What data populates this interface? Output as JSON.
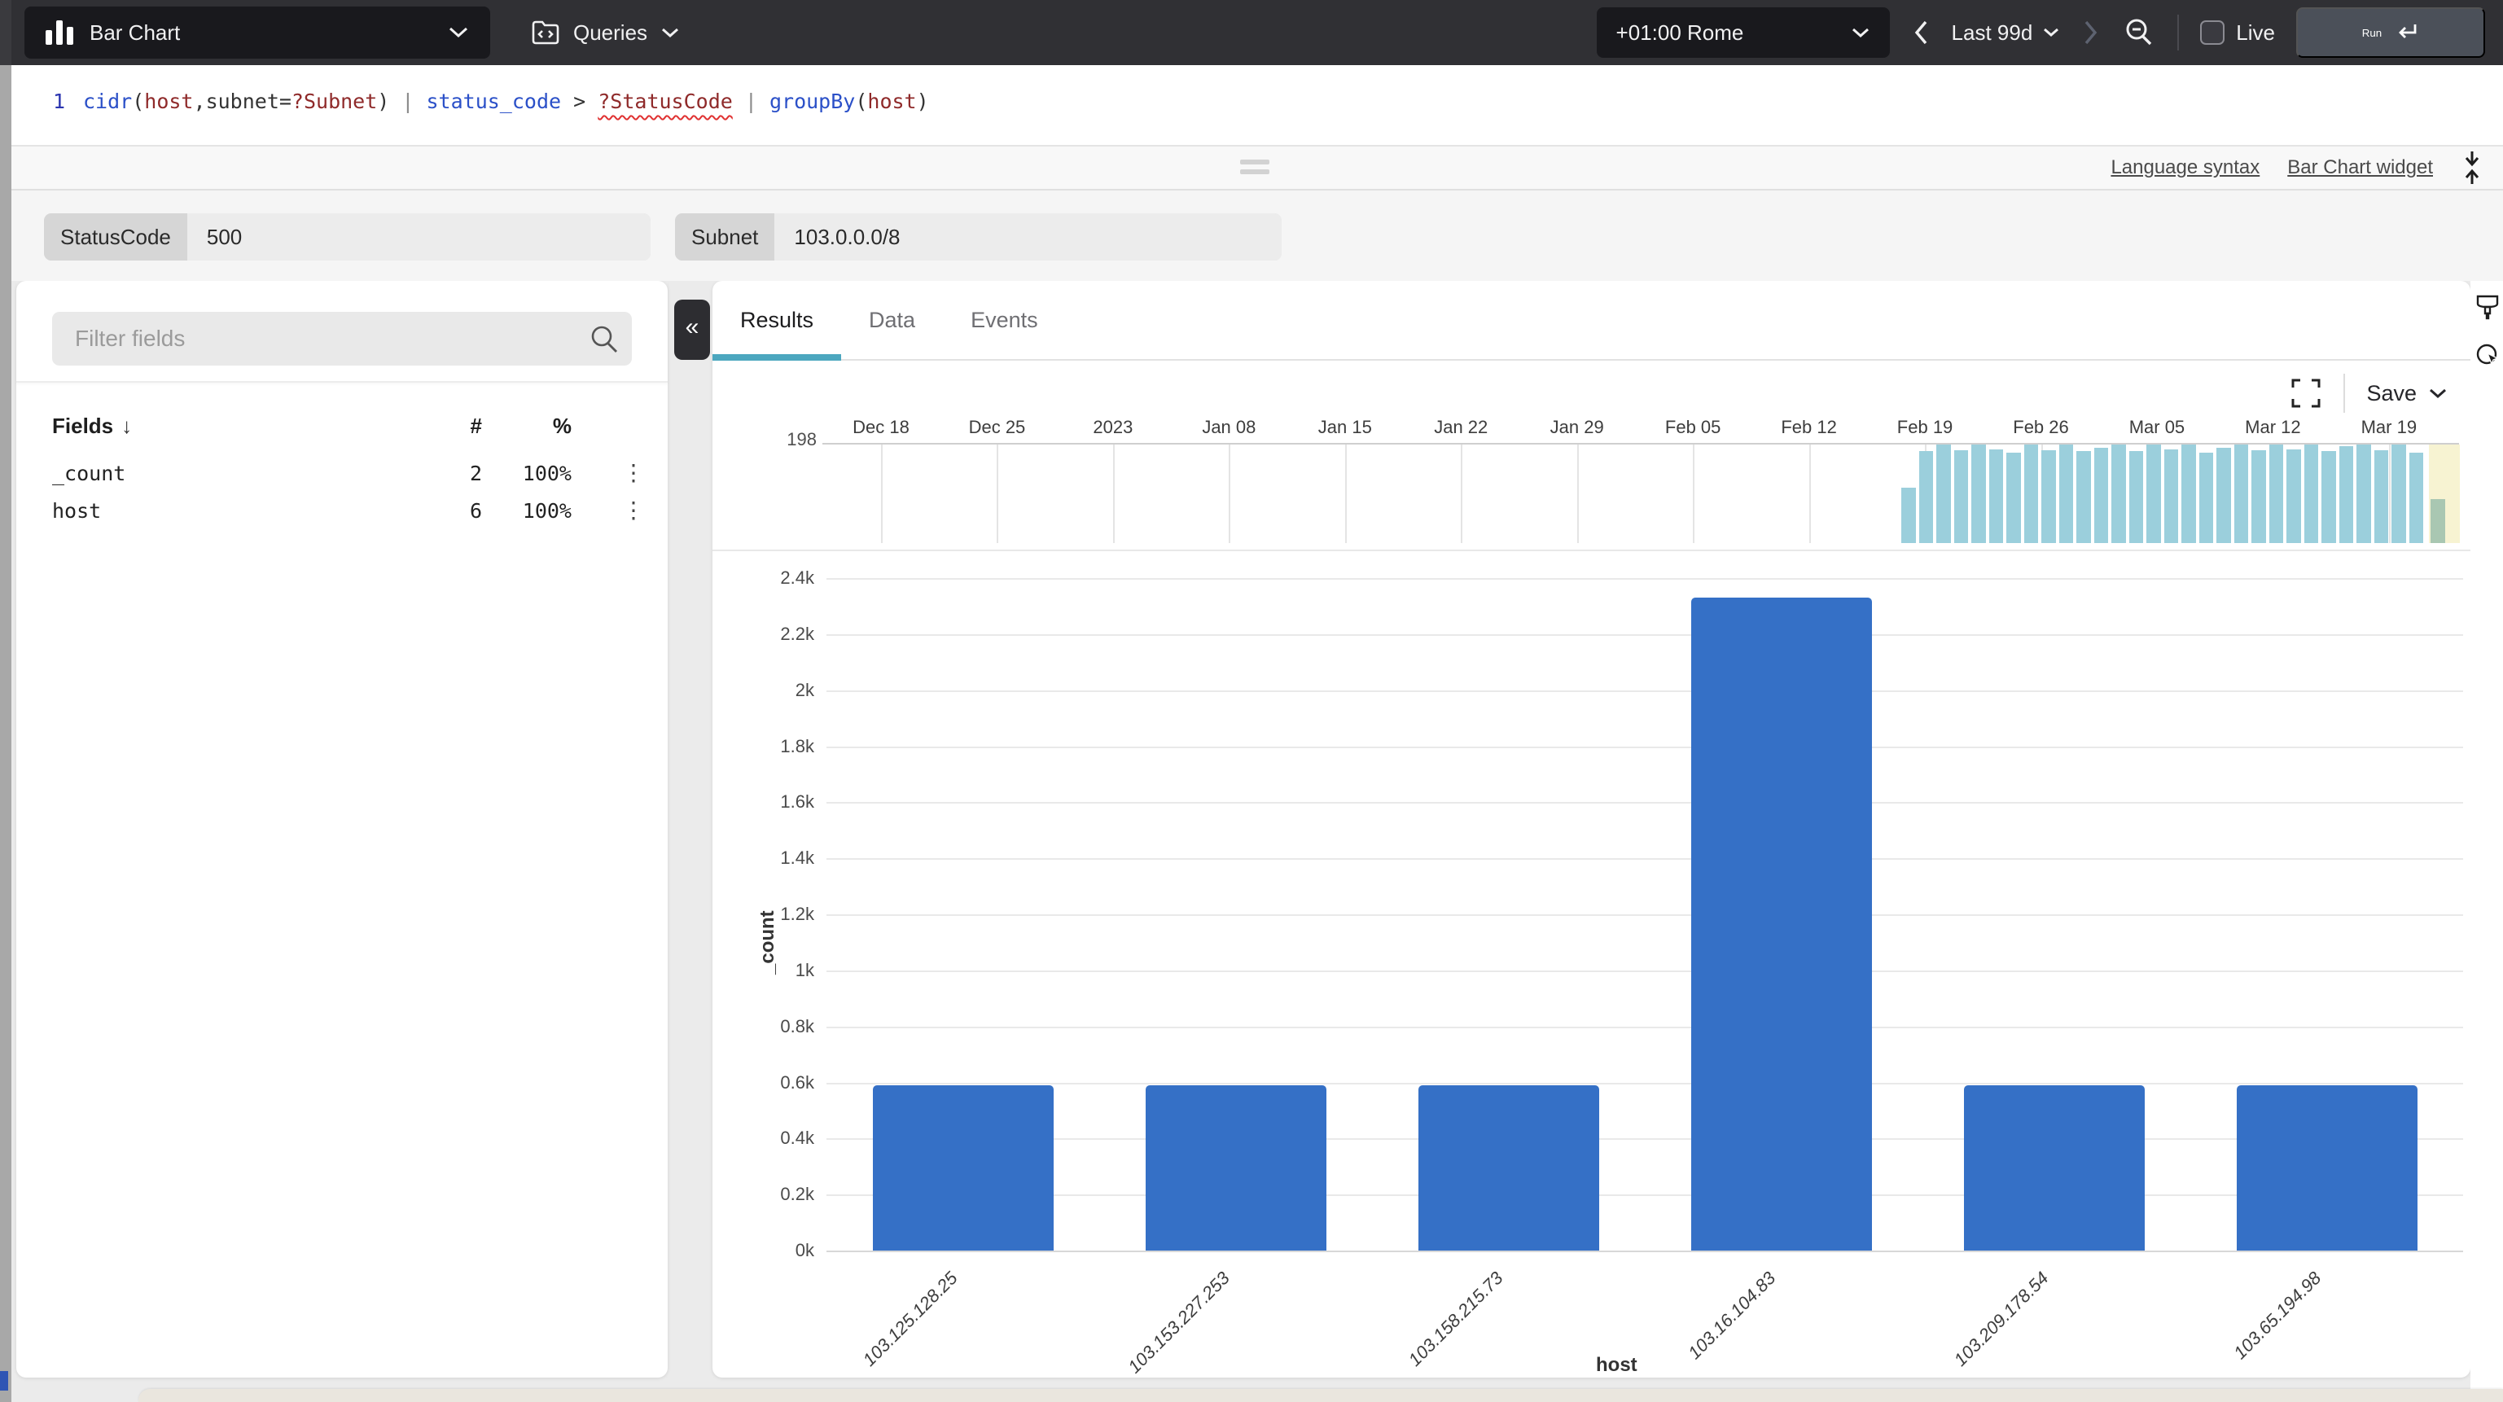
{
  "topbar": {
    "widget_selector_label": "Bar Chart",
    "queries_label": "Queries",
    "timezone": "+01:00 Rome",
    "time_range_label": "Last 99d",
    "live_label": "Live",
    "run_label": "Run"
  },
  "query_bar": {
    "line_number": "1",
    "tokens": [
      {
        "text": "cidr",
        "type": "fn"
      },
      {
        "text": "(",
        "type": "punct"
      },
      {
        "text": "host",
        "type": "arg"
      },
      {
        "text": ",",
        "type": "punct"
      },
      {
        "text": "subnet=",
        "type": "punct"
      },
      {
        "text": "?Subnet",
        "type": "arg"
      },
      {
        "text": ")",
        "type": "punct"
      },
      {
        "text": " | ",
        "type": "pipe"
      },
      {
        "text": "status_code",
        "type": "fn"
      },
      {
        "text": " > ",
        "type": "punct"
      },
      {
        "text": "?StatusCode",
        "type": "arg-err"
      },
      {
        "text": " | ",
        "type": "pipe"
      },
      {
        "text": "groupBy",
        "type": "fn"
      },
      {
        "text": "(",
        "type": "punct"
      },
      {
        "text": "host",
        "type": "arg"
      },
      {
        "text": ")",
        "type": "punct"
      }
    ]
  },
  "help_links": {
    "language_syntax": "Language syntax",
    "widget_docs": "Bar Chart widget"
  },
  "parameters": [
    {
      "label": "StatusCode",
      "value": "500"
    },
    {
      "label": "Subnet",
      "value": "103.0.0.0/8"
    }
  ],
  "fields_panel": {
    "filter_placeholder": "Filter fields",
    "columns": {
      "name": "Fields",
      "count": "#",
      "percent": "%"
    },
    "rows": [
      {
        "name": "_count",
        "count": "2",
        "percent": "100%"
      },
      {
        "name": "host",
        "count": "6",
        "percent": "100%"
      }
    ]
  },
  "results_panel": {
    "tabs": [
      {
        "label": "Results",
        "active": true
      },
      {
        "label": "Data",
        "active": false
      },
      {
        "label": "Events",
        "active": false
      }
    ],
    "save_label": "Save",
    "timeline": {
      "max_label": "198",
      "ticks": [
        "Dec 18",
        "Dec 25",
        "2023",
        "Jan 08",
        "Jan 15",
        "Jan 22",
        "Jan 29",
        "Feb 05",
        "Feb 12",
        "Feb 19",
        "Feb 26",
        "Mar 05",
        "Mar 12",
        "Mar 19"
      ],
      "bars": [
        0.56,
        0.93,
        1,
        0.94,
        1,
        0.95,
        0.92,
        1,
        0.94,
        1,
        0.93,
        0.97,
        1,
        0.93,
        1,
        0.95,
        1,
        0.92,
        0.97,
        1,
        0.94,
        1,
        0.95,
        1,
        0.93,
        0.98,
        1,
        0.94,
        1,
        0.92
      ],
      "partial_bar": 0.45,
      "bar_color": "#9bcfdc",
      "partial_bar_color": "#a9c7b2",
      "partial_bg_color": "#f7f3d2"
    }
  },
  "chart_data": {
    "type": "bar",
    "title": "",
    "xlabel": "host",
    "ylabel": "_count",
    "categories": [
      "103.125.128.25",
      "103.153.227.253",
      "103.158.215.73",
      "103.16.104.83",
      "103.209.178.54",
      "103.65.194.98"
    ],
    "values": [
      590,
      590,
      590,
      2330,
      590,
      590
    ],
    "ylim": [
      0,
      2400
    ],
    "ytick_step": 200,
    "ytick_labels": [
      "0k",
      "0.2k",
      "0.4k",
      "0.6k",
      "0.8k",
      "1k",
      "1.2k",
      "1.4k",
      "1.6k",
      "1.8k",
      "2k",
      "2.2k",
      "2.4k"
    ],
    "bar_color": "#3570c6",
    "grid": true,
    "legend": false
  },
  "colors": {
    "accent_teal": "#4ca7bf",
    "bar_blue": "#3570c6",
    "timeline_teal": "#9bcfdc",
    "topbar_bg": "#303034",
    "run_button_bg": "#4b5059"
  }
}
